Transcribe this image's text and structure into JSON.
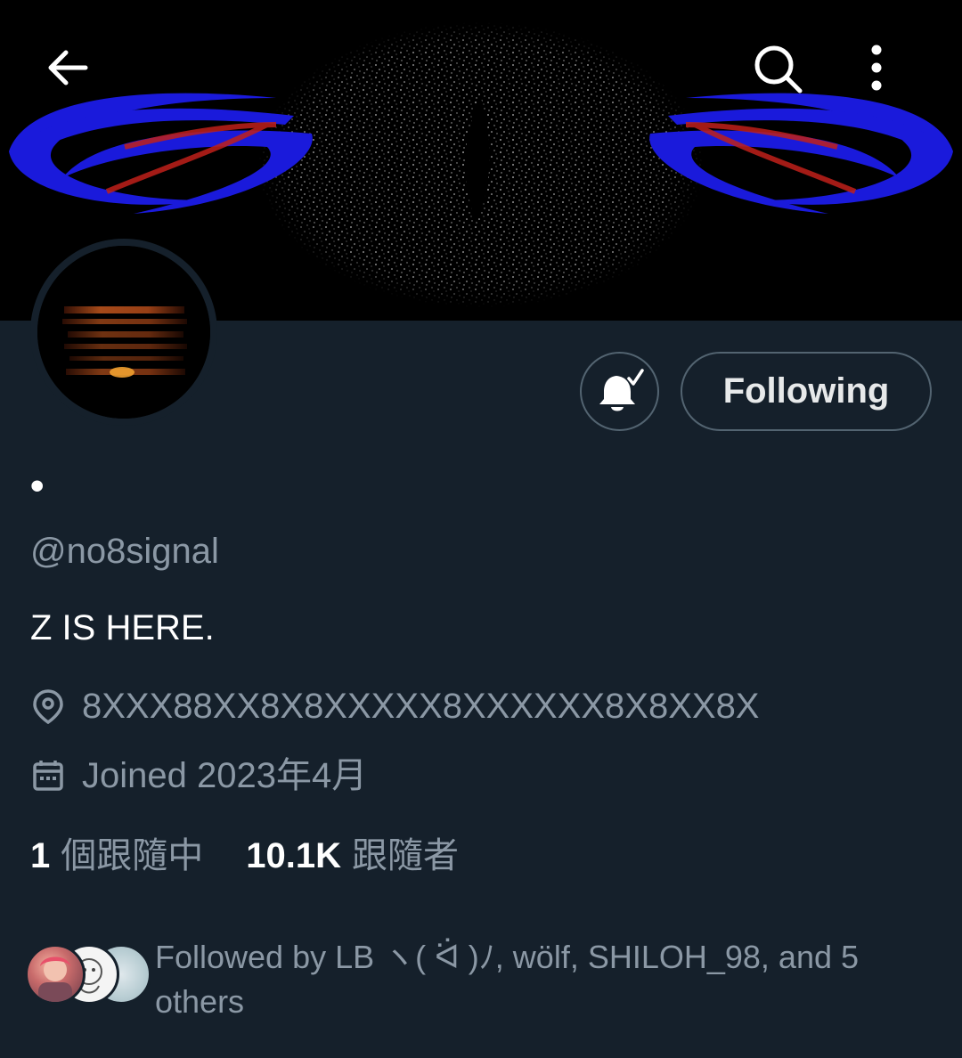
{
  "header": {
    "back_icon": "arrow-left-icon",
    "search_icon": "search-icon",
    "more_icon": "more-vertical-icon"
  },
  "profile": {
    "display_name": "•",
    "handle": "@no8signal",
    "bio": "Z IS HERE.",
    "location": "8XXX88XX8X8XXXXX8XXXXXX8X8XX8X",
    "joined": "Joined 2023年4月",
    "notify_icon": "bell-check-icon",
    "follow_button_label": "Following"
  },
  "stats": {
    "following_count": "1",
    "following_label": "個跟隨中",
    "followers_count": "10.1K",
    "followers_label": "跟隨者"
  },
  "followed_by": {
    "text": "Followed by LB ヽ( ᐛ )ﾉ, wölf, SHILOH_98, and 5 others"
  },
  "colors": {
    "background": "#15202b",
    "secondary_text": "#8b98a5",
    "border": "#536471",
    "banner_blue": "#1a1adb",
    "banner_red": "#c0201a"
  }
}
